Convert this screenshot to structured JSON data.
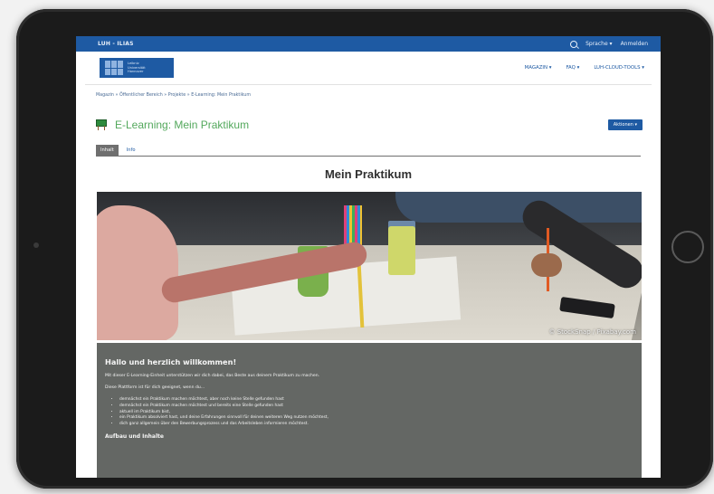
{
  "topbar": {
    "brand": "LUH - ILIAS",
    "language": "Sprache ▾",
    "login": "Anmelden"
  },
  "logo": {
    "line1": "Leibniz",
    "line2": "Universität",
    "line3": "Hannover"
  },
  "mainnav": {
    "items": [
      "MAGAZIN ▾",
      "FAQ ▾",
      "LUH-CLOUD-TOOLS ▾"
    ]
  },
  "breadcrumb": "Magazin » Öffentlicher Bereich » Projekte » E-Learning: Mein Praktikum",
  "page": {
    "title": "E-Learning: Mein Praktikum",
    "actions_label": "Aktionen ▾"
  },
  "tabs": [
    {
      "label": "Inhalt",
      "active": true
    },
    {
      "label": "Info",
      "active": false
    }
  ],
  "content": {
    "heading": "Mein Praktikum",
    "image_credit": "© StockSnap / Pixabay.com"
  },
  "welcome": {
    "heading": "Hallo und herzlich willkommen!",
    "intro": "Mit dieser E-Learning-Einheit unterstützen wir dich dabei, das Beste aus deinem Praktikum zu machen.",
    "lead": "Diese Plattform ist für dich geeignet, wenn du...",
    "bullets": [
      "demnächst ein Praktikum machen möchtest, aber noch keine Stelle gefunden hast",
      "demnächst ein Praktikum machen möchtest und bereits eine Stelle gefunden hast",
      "aktuell im Praktikum bist,",
      "ein Praktikum absolviert hast, und deine Erfahrungen sinnvoll für deinen weiteren Weg nutzen möchtest,",
      "dich ganz allgemein über den Bewerbungsprozess und das Arbeitsleben informieren möchtest."
    ],
    "section_heading": "Aufbau und Inhalte"
  },
  "colors": {
    "brand_blue": "#1e5aa3",
    "title_green": "#53a85c",
    "welcome_bg": "#646764"
  }
}
